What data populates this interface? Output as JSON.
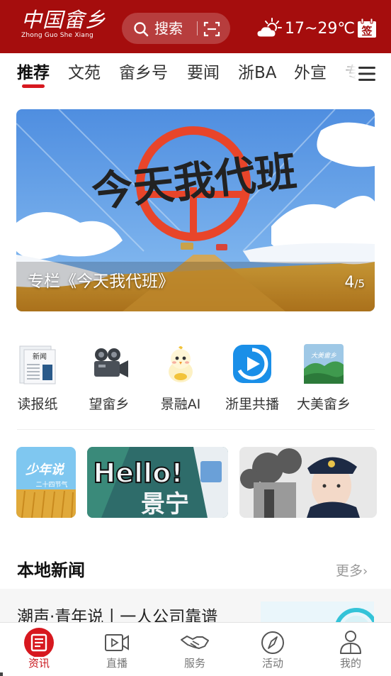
{
  "header": {
    "logo_main": "中国畲乡",
    "logo_sub": "Zhong Guo She Xiang",
    "search_placeholder": "搜索",
    "weather_text": "17~29℃",
    "signin_label": "签"
  },
  "tabs": [
    {
      "label": "推荐",
      "active": true
    },
    {
      "label": "文苑"
    },
    {
      "label": "畲乡号"
    },
    {
      "label": "要闻"
    },
    {
      "label": "浙BA"
    },
    {
      "label": "外宣"
    },
    {
      "label": "专"
    }
  ],
  "banner": {
    "art_text": "今天我代班",
    "caption": "专栏《今天我代班》",
    "page_current": "4",
    "page_total": "/5"
  },
  "shortcuts": [
    {
      "label": "读报纸",
      "icon": "newspaper-icon",
      "icon_text": "新闻"
    },
    {
      "label": "望畲乡",
      "icon": "video-camera-icon"
    },
    {
      "label": "景融AI",
      "icon": "chick-mascot-icon"
    },
    {
      "label": "浙里共播",
      "icon": "play-logo-icon"
    },
    {
      "label": "大美畲乡",
      "icon": "landscape-icon",
      "icon_text": "大美畲乡"
    }
  ],
  "promos": [
    {
      "name": "promo-youth-solar-terms",
      "text": "少年说",
      "sub": "二十四节气"
    },
    {
      "name": "promo-hello-jingning",
      "text": "Hello!",
      "sub": "景宁"
    },
    {
      "name": "promo-police-officer",
      "text": ""
    }
  ],
  "local_news": {
    "title": "本地新闻",
    "more": "更多",
    "first_item": "潮声·青年说丨一人公司靠谱"
  },
  "bottom_nav": [
    {
      "label": "资讯",
      "icon": "news-icon",
      "active": true
    },
    {
      "label": "直播",
      "icon": "live-video-icon"
    },
    {
      "label": "服务",
      "icon": "handshake-icon"
    },
    {
      "label": "活动",
      "icon": "compass-icon"
    },
    {
      "label": "我的",
      "icon": "user-icon"
    }
  ],
  "colors": {
    "brand_red": "#a50d0d",
    "active_red": "#c8141a",
    "tab_underline": "#d7181f"
  }
}
